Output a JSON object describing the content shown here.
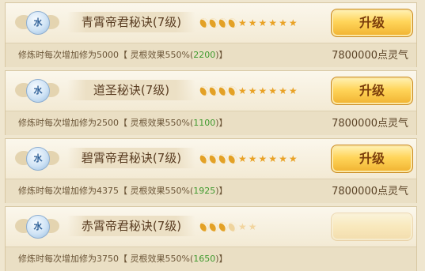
{
  "skills": [
    {
      "element_badge": "水",
      "name": "青霄帝君秘诀(7级)",
      "desc_prefix": "修炼时每次增加修为",
      "desc_value": "5000",
      "desc_mid": "【 灵根效果550%(",
      "desc_bonus": "2200",
      "desc_suffix": ")】",
      "cost": "7800000点灵气",
      "upgrade_label": "升级",
      "moons": 4,
      "stars": 6
    },
    {
      "element_badge": "水",
      "name": "道圣秘诀(7级)",
      "desc_prefix": "修炼时每次增加修为",
      "desc_value": "2500",
      "desc_mid": "【 灵根效果550%(",
      "desc_bonus": "1100",
      "desc_suffix": ")】",
      "cost": "7800000点灵气",
      "upgrade_label": "升级",
      "moons": 4,
      "stars": 6
    },
    {
      "element_badge": "水",
      "name": "碧霄帝君秘诀(7级)",
      "desc_prefix": "修炼时每次增加修为",
      "desc_value": "4375",
      "desc_mid": "【 灵根效果550%(",
      "desc_bonus": "1925",
      "desc_suffix": ")】",
      "cost": "7800000点灵气",
      "upgrade_label": "升级",
      "moons": 4,
      "stars": 6
    },
    {
      "element_badge": "水",
      "name": "赤霄帝君秘诀(7级)",
      "desc_prefix": "修炼时每次增加修为",
      "desc_value": "3750",
      "desc_mid": "【 灵根效果550%(",
      "desc_bonus": "1650",
      "desc_suffix": ")】",
      "cost": "",
      "upgrade_label": "",
      "moons": 4,
      "stars": 2
    }
  ],
  "colors": {
    "accent_gold": "#ffd55a",
    "bonus_green": "#3f9a2e",
    "badge_blue": "#2d5f97"
  }
}
